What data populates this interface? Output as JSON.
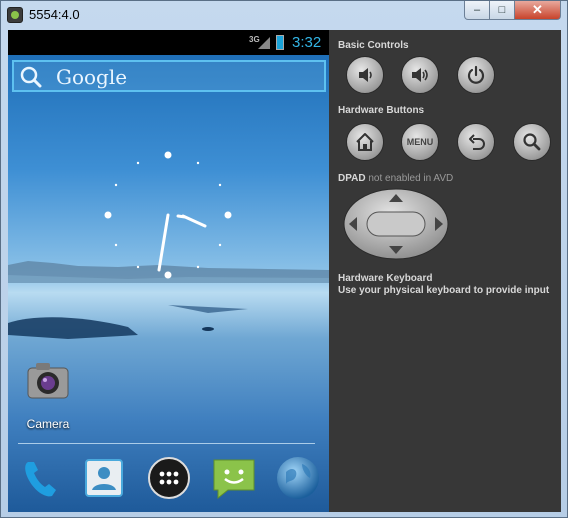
{
  "window": {
    "title": "5554:4.0",
    "min_glyph": "–",
    "max_glyph": "□",
    "close_glyph": "✕"
  },
  "statusbar": {
    "network": "3G",
    "time": "3:32"
  },
  "search": {
    "text": "Google"
  },
  "apps": {
    "camera_label": "Camera"
  },
  "dock": [
    "phone-icon",
    "contacts-icon",
    "app-drawer-icon",
    "messaging-icon",
    "browser-icon"
  ],
  "panel": {
    "basic_controls": "Basic Controls",
    "hardware_buttons": "Hardware Buttons",
    "menu_label": "MENU",
    "dpad_label": "DPAD",
    "dpad_note": "not enabled in AVD",
    "keyboard_title": "Hardware Keyboard",
    "keyboard_hint": "Use your physical keyboard to provide input"
  },
  "colors": {
    "accent": "#33b5e5",
    "panel_bg": "#373737"
  }
}
